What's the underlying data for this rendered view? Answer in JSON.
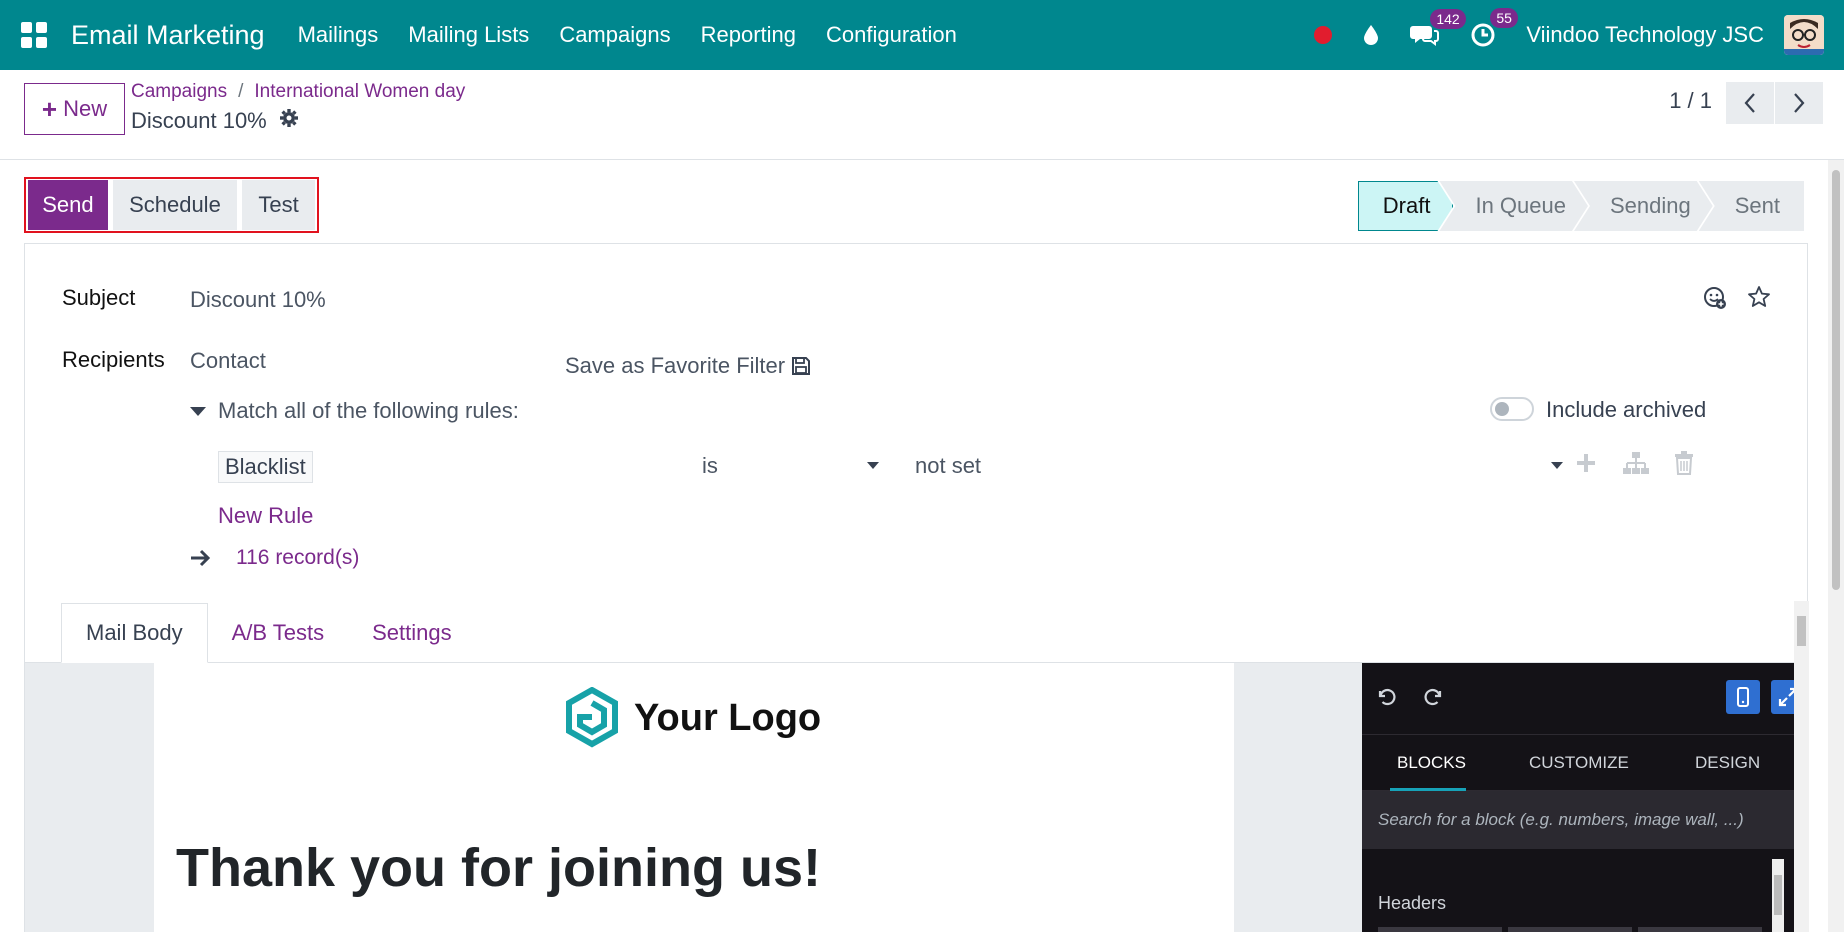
{
  "navbar": {
    "app_title": "Email Marketing",
    "menu": [
      "Mailings",
      "Mailing Lists",
      "Campaigns",
      "Reporting",
      "Configuration"
    ],
    "messages_count": "142",
    "activities_count": "55",
    "company": "Viindoo Technology JSC",
    "colors": {
      "bar": "#00878e",
      "recording": "#e11d2e",
      "badge": "#7b2a8c"
    }
  },
  "control": {
    "new_label": "New",
    "breadcrumb": [
      "Campaigns",
      "International Women day"
    ],
    "record_name": "Discount 10%",
    "pager": "1 / 1"
  },
  "actions": {
    "send": "Send",
    "schedule": "Schedule",
    "test": "Test"
  },
  "status": {
    "stages": [
      "Draft",
      "In Queue",
      "Sending",
      "Sent"
    ],
    "current": "Draft"
  },
  "form": {
    "subject_label": "Subject",
    "subject_value": "Discount 10%",
    "recipients_label": "Recipients",
    "recipients_value": "Contact",
    "save_favorite": "Save as Favorite Filter",
    "match_text": "Match all of the following rules:",
    "include_archived": "Include archived",
    "include_archived_on": false,
    "rule": {
      "field": "Blacklist",
      "operator": "is",
      "value": "not set"
    },
    "new_rule": "New Rule",
    "records": "116 record(s)"
  },
  "tabs": [
    "Mail Body",
    "A/B Tests",
    "Settings"
  ],
  "active_tab": "Mail Body",
  "mail": {
    "logo_text": "Your Logo",
    "heading": "Thank you for joining us!"
  },
  "snippets": {
    "tabs": [
      "BLOCKS",
      "CUSTOMIZE",
      "DESIGN"
    ],
    "active_tab": "BLOCKS",
    "search_placeholder": "Search for a block (e.g. numbers, image wall, ...)",
    "section": "Headers"
  }
}
